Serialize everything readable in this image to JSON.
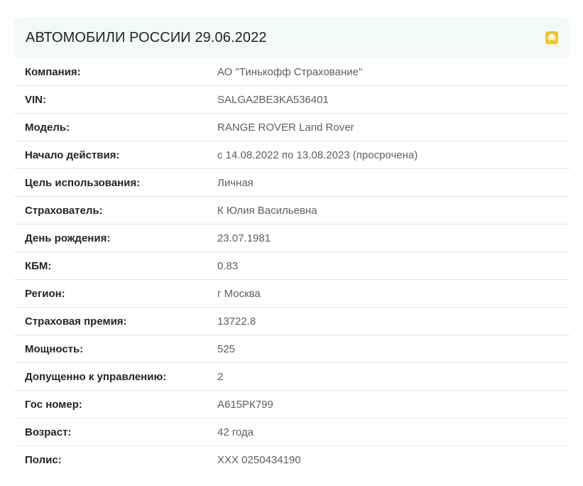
{
  "header": {
    "title": "АВТОМОБИЛИ РОССИИ 29.06.2022",
    "icon": "car-icon",
    "icon_color": "#f5c518"
  },
  "rows": [
    {
      "label": "Компания:",
      "value": "АО \"Тинькофф Страхование\""
    },
    {
      "label": "VIN:",
      "value": "SALGA2BE3KA536401"
    },
    {
      "label": "Модель:",
      "value": "RANGE ROVER Land Rover"
    },
    {
      "label": "Начало действия:",
      "value": "с 14.08.2022 по 13.08.2023 (просрочена)"
    },
    {
      "label": "Цель использования:",
      "value": "Личная"
    },
    {
      "label": "Страхователь:",
      "value": "К Юлия Васильевна"
    },
    {
      "label": "День рождения:",
      "value": "23.07.1981"
    },
    {
      "label": "КБМ:",
      "value": "0.83"
    },
    {
      "label": "Регион:",
      "value": "г Москва"
    },
    {
      "label": "Страховая премия:",
      "value": "13722.8"
    },
    {
      "label": "Мощность:",
      "value": "525"
    },
    {
      "label": "Допущенно к управлению:",
      "value": "2"
    },
    {
      "label": "Гос номер:",
      "value": "А615РК799"
    },
    {
      "label": "Возраст:",
      "value": "42 года"
    },
    {
      "label": "Полис:",
      "value": "ХХХ 0250434190"
    }
  ]
}
